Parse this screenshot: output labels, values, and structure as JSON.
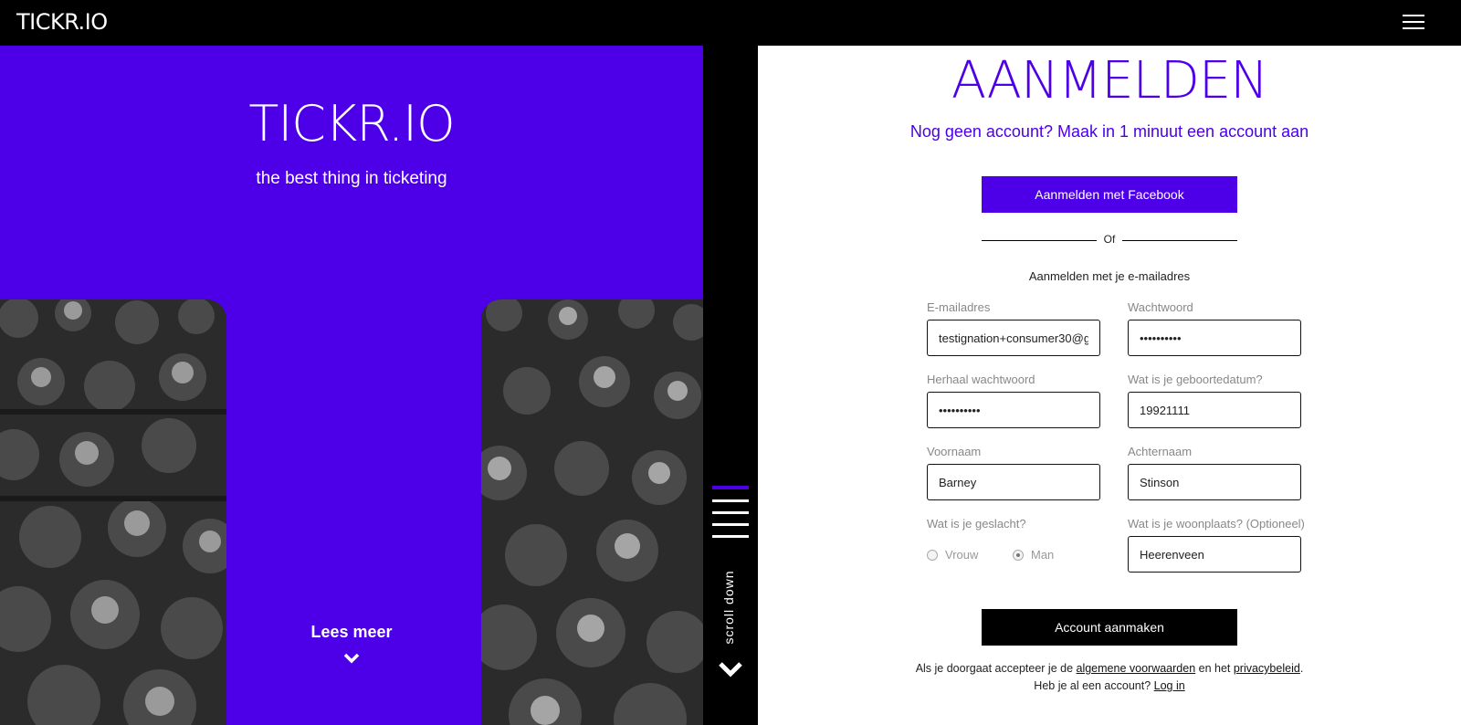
{
  "topbar": {
    "brand": "TICKR.IO",
    "menu_icon": "hamburger-menu-icon"
  },
  "hero": {
    "title": "TICKR.IO",
    "subtitle": "the best thing in ticketing",
    "read_more": "Lees meer",
    "read_more_icon": "chevron-down-icon",
    "accent_color": "#4d00e8"
  },
  "strip": {
    "scroll_label": "scroll down",
    "scroll_icon": "chevron-down-icon",
    "menu_icon": "lines-icon"
  },
  "form": {
    "title": "AANMELDEN",
    "signup_prompt": "Nog geen account? Maak in 1 minuut een account aan",
    "facebook_button": "Aanmelden met Facebook",
    "or_label": "Of",
    "email_heading": "Aanmelden met je e-mailadres",
    "fields": {
      "email": {
        "label": "E-mailadres",
        "value": "testignation+consumer30@g"
      },
      "password": {
        "label": "Wachtwoord",
        "value": "••••••••••"
      },
      "repeat_password": {
        "label": "Herhaal wachtwoord",
        "value": "••••••••••"
      },
      "birthdate": {
        "label": "Wat is je geboortedatum?",
        "value": "19921111"
      },
      "first_name": {
        "label": "Voornaam",
        "value": "Barney"
      },
      "last_name": {
        "label": "Achternaam",
        "value": "Stinson"
      },
      "gender": {
        "label": "Wat is je geslacht?",
        "option_female": "Vrouw",
        "option_male": "Man",
        "selected": "Man"
      },
      "city": {
        "label": "Wat is je woonplaats? (Optioneel)",
        "value": "Heerenveen"
      }
    },
    "create_button": "Account aanmaken",
    "legal": {
      "text1": "Als je doorgaat accepteer je de ",
      "terms_link": "algemene voorwaarden",
      "text2": " en het ",
      "privacy_link": "privacybeleid",
      "text3": ".",
      "login_prompt": "Heb je al een account? ",
      "login_link": "Log in"
    }
  }
}
